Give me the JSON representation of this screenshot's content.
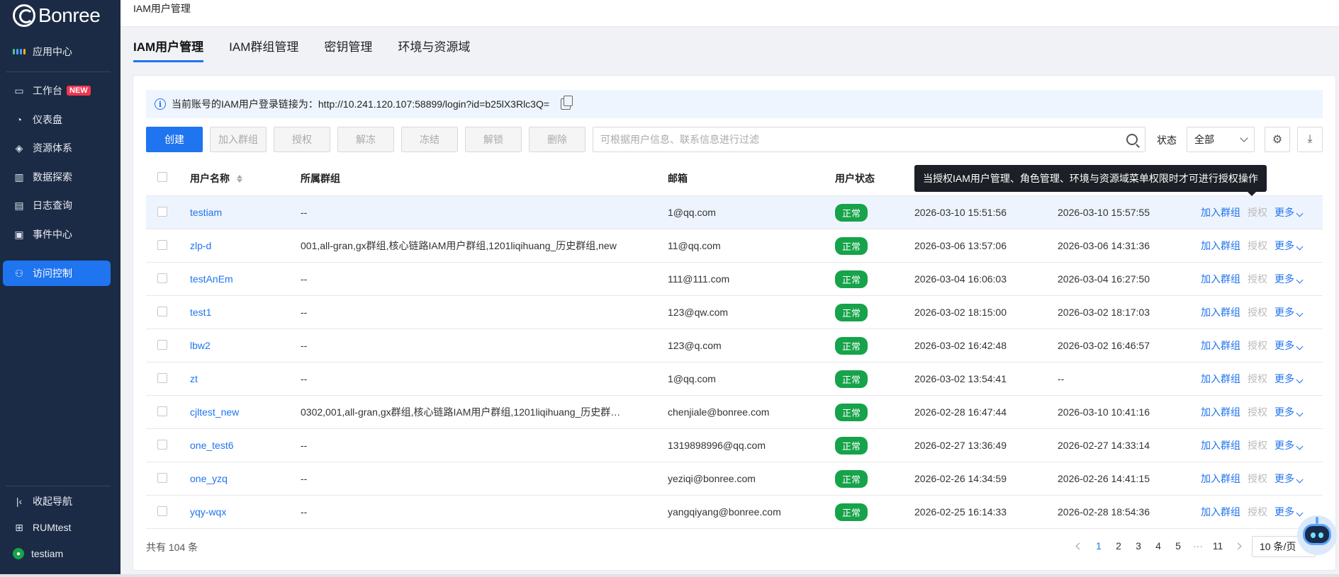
{
  "app": {
    "logo_text": "Bonree"
  },
  "sidebar": {
    "items": [
      {
        "label": "应用中心",
        "icon": "apps-grid-icon"
      },
      {
        "label": "工作台",
        "icon": "workbench-icon",
        "badge": "NEW"
      },
      {
        "label": "仪表盘",
        "icon": "dashboard-gauge-icon"
      },
      {
        "label": "资源体系",
        "icon": "layers-icon"
      },
      {
        "label": "数据探索",
        "icon": "bar-chart-icon"
      },
      {
        "label": "日志查询",
        "icon": "log-document-icon"
      },
      {
        "label": "事件中心",
        "icon": "event-folder-icon"
      },
      {
        "label": "访问控制",
        "icon": "user-access-icon",
        "active": true
      }
    ],
    "bottom": [
      {
        "label": "收起导航",
        "icon": "collapse-icon"
      },
      {
        "label": "RUMtest",
        "icon": "workspace-grid-icon"
      },
      {
        "label": "testiam",
        "icon": "user-avatar-icon"
      }
    ],
    "colors": {
      "bg": "#1c2b45",
      "active": "#1f74ef"
    }
  },
  "header": {
    "breadcrumb": "IAM用户管理"
  },
  "tabs": [
    {
      "label": "IAM用户管理",
      "active": true
    },
    {
      "label": "IAM群组管理"
    },
    {
      "label": "密钥管理"
    },
    {
      "label": "环境与资源域"
    }
  ],
  "info": {
    "text": "当前账号的IAM用户登录链接为：http://10.241.120.107:58899/login?id=b25lX3Rlc3Q="
  },
  "toolbar": {
    "create": "创建",
    "add_group": "加入群组",
    "authorize": "授权",
    "unfreeze": "解冻",
    "freeze": "冻结",
    "unlock": "解锁",
    "delete": "删除",
    "search_placeholder": "可根据用户信息、联系信息进行过滤",
    "status_label": "状态",
    "status_value": "全部"
  },
  "table": {
    "headers": {
      "name": "用户名称",
      "group": "所属群组",
      "email": "邮箱",
      "status": "用户状态"
    },
    "action_labels": {
      "add_group": "加入群组",
      "authorize": "授权",
      "more": "更多"
    },
    "rows": [
      {
        "name": "testiam",
        "group": "--",
        "email": "1@qq.com",
        "status": "正常",
        "created": "2026-03-10 15:51:56",
        "updated": "2026-03-10 15:57:55"
      },
      {
        "name": "zlp-d",
        "group": "001,all-gran,gx群组,核心链路IAM用户群组,1201liqihuang_历史群组,new",
        "email": "11@qq.com",
        "status": "正常",
        "created": "2026-03-06 13:57:06",
        "updated": "2026-03-06 14:31:36"
      },
      {
        "name": "testAnEm",
        "group": "--",
        "email": "111@111.com",
        "status": "正常",
        "created": "2026-03-04 16:06:03",
        "updated": "2026-03-04 16:27:50"
      },
      {
        "name": "test1",
        "group": "--",
        "email": "123@qw.com",
        "status": "正常",
        "created": "2026-03-02 18:15:00",
        "updated": "2026-03-02 18:17:03"
      },
      {
        "name": "lbw2",
        "group": "--",
        "email": "123@q.com",
        "status": "正常",
        "created": "2026-03-02 16:42:48",
        "updated": "2026-03-02 16:46:57"
      },
      {
        "name": "zt",
        "group": "--",
        "email": "1@qq.com",
        "status": "正常",
        "created": "2026-03-02 13:54:41",
        "updated": "--"
      },
      {
        "name": "cjltest_new",
        "group": "0302,001,all-gran,gx群组,核心链路IAM用户群组,1201liqihuang_历史群…",
        "email": "chenjiale@bonree.com",
        "status": "正常",
        "created": "2026-02-28 16:47:44",
        "updated": "2026-03-10 10:41:16"
      },
      {
        "name": "one_test6",
        "group": "--",
        "email": "1319898996@qq.com",
        "status": "正常",
        "created": "2026-02-27 13:36:49",
        "updated": "2026-02-27 14:33:14"
      },
      {
        "name": "one_yzq",
        "group": "--",
        "email": "yeziqi@bonree.com",
        "status": "正常",
        "created": "2026-02-26 14:34:59",
        "updated": "2026-02-26 14:41:15"
      },
      {
        "name": "yqy-wqx",
        "group": "--",
        "email": "yangqiyang@bonree.com",
        "status": "正常",
        "created": "2026-02-25 16:14:33",
        "updated": "2026-02-28 18:54:36"
      }
    ]
  },
  "tooltip": {
    "text": "当授权IAM用户管理、角色管理、环境与资源域菜单权限时才可进行授权操作"
  },
  "footer": {
    "total": "共有 104 条",
    "pages": [
      "1",
      "2",
      "3",
      "4",
      "5"
    ],
    "ellipsis": "···",
    "last_page": "11",
    "current_page": "1",
    "page_size": "10 条/页"
  }
}
